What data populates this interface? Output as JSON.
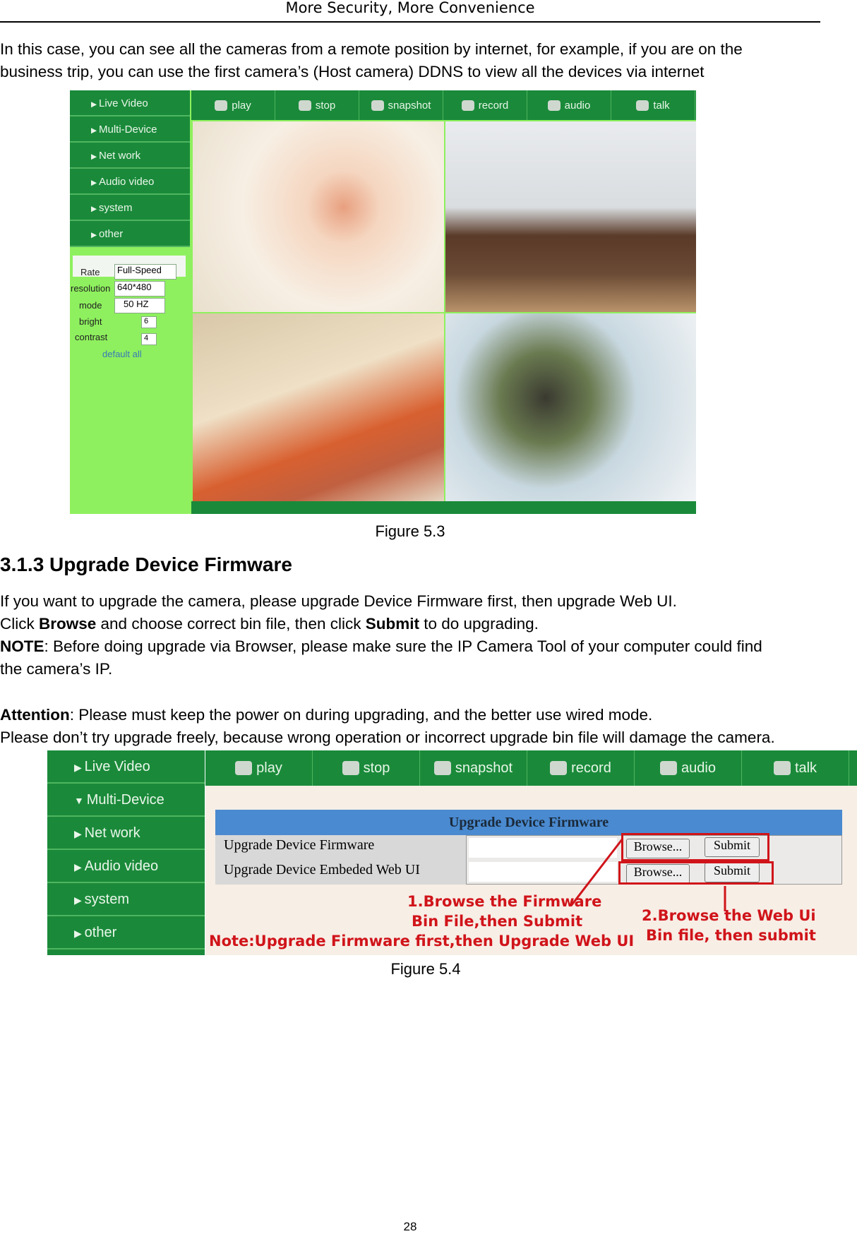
{
  "header": {
    "title": "More Security, More Convenience"
  },
  "intro": [
    "In this case, you can see all the cameras from a remote position by internet, for example, if you are on the",
    "business trip, you can use the first camera’s (Host camera) DDNS to view all the devices via internet"
  ],
  "figure1": {
    "caption": "Figure 5.3",
    "menu": [
      "Live Video",
      "Multi-Device",
      "Net work",
      "Audio video",
      "system",
      "other"
    ],
    "toolbar": [
      {
        "icon": "play-icon",
        "label": "play"
      },
      {
        "icon": "stop-icon",
        "label": "stop"
      },
      {
        "icon": "snapshot-icon",
        "label": "snapshot"
      },
      {
        "icon": "record-icon",
        "label": "record"
      },
      {
        "icon": "audio-icon",
        "label": "audio"
      },
      {
        "icon": "talk-icon",
        "label": "talk"
      }
    ],
    "controls": {
      "rate_label": "Rate",
      "rate": "Full-Speed",
      "resolution_label": "resolution",
      "resolution": "640*480",
      "mode_label": "mode",
      "mode": "50 HZ",
      "bright_label": "bright",
      "bright": "6",
      "contrast_label": "contrast",
      "contrast": "4",
      "default_all": "default all"
    }
  },
  "section": {
    "heading": "3.1.3 Upgrade Device Firmware",
    "p1": "If you want to upgrade the camera, please upgrade Device Firmware first, then upgrade Web UI.",
    "p2": {
      "a": "Click ",
      "b": "Browse",
      "c": " and choose correct bin file, then click ",
      "d": "Submit",
      "e": " to do upgrading."
    },
    "p3": {
      "a": "NOTE",
      "b": ": Before doing upgrade via Browser, please make sure the IP Camera Tool of your computer could find",
      "c": "the camera’s IP."
    },
    "p4": {
      "a": "Attention",
      "b": ": Please must keep the power on during upgrading, and the better use wired mode."
    },
    "p5": "Please don’t try upgrade freely, because wrong operation or incorrect upgrade bin file will damage the camera."
  },
  "figure2": {
    "caption": "Figure 5.4",
    "menu": [
      "Live Video",
      "Multi-Device",
      "Net work",
      "Audio video",
      "system",
      "other"
    ],
    "table_title": "Upgrade Device Firmware",
    "rows": [
      {
        "label": "Upgrade Device Firmware",
        "browse": "Browse...",
        "submit": "Submit"
      },
      {
        "label": "Upgrade Device Embeded Web UI",
        "browse": "Browse...",
        "submit": "Submit"
      }
    ],
    "annot1": [
      "1.Browse   the Firmware",
      "Bin File,then Submit"
    ],
    "annot2": [
      "2.Browse  the Web Ui",
      "Bin file, then submit"
    ],
    "note": "Note:Upgrade Firmware first,then Upgrade Web UI"
  },
  "page_number": "28"
}
